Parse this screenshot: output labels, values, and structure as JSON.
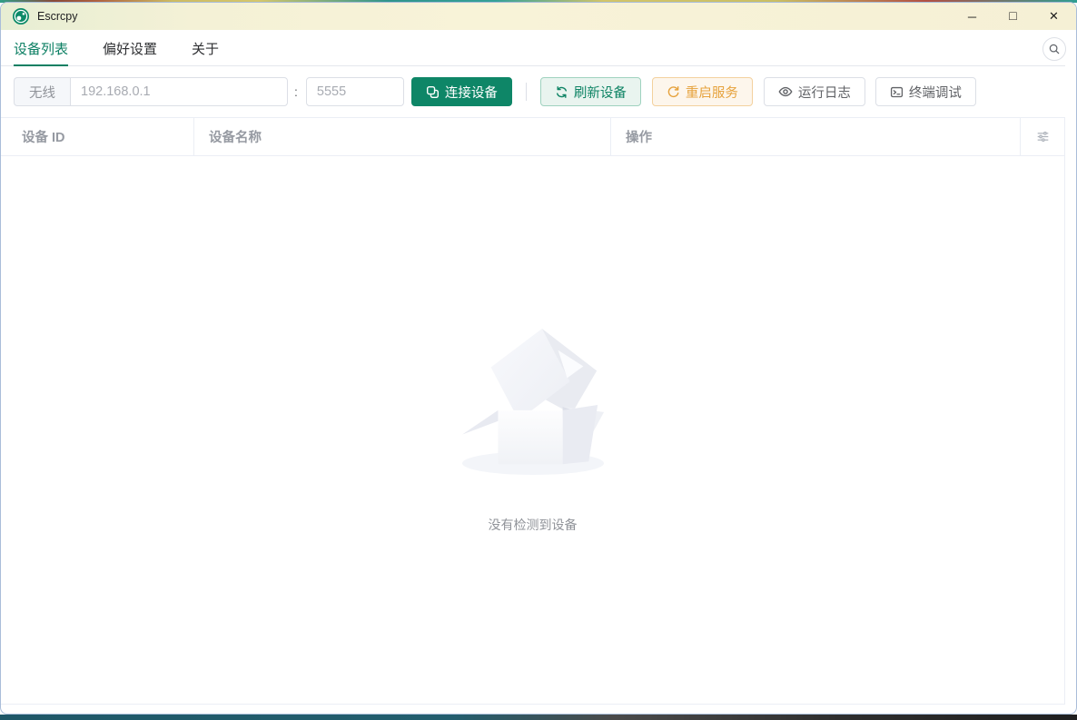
{
  "window": {
    "title": "Escrcpy",
    "controls": {
      "minimize": "─",
      "maximize": "□",
      "close": "✕"
    }
  },
  "tabs": [
    {
      "label": "设备列表",
      "active": true
    },
    {
      "label": "偏好设置",
      "active": false
    },
    {
      "label": "关于",
      "active": false
    }
  ],
  "toolbar": {
    "wireless_label": "无线",
    "ip_placeholder": "192.168.0.1",
    "port_separator": ":",
    "port_placeholder": "5555",
    "connect_label": "连接设备",
    "refresh_label": "刷新设备",
    "restart_label": "重启服务",
    "log_label": "运行日志",
    "terminal_label": "终端调试"
  },
  "table": {
    "columns": [
      "设备 ID",
      "设备名称",
      "操作"
    ]
  },
  "empty": {
    "description": "没有检测到设备"
  },
  "icons": {
    "app": "escrcpy-logo",
    "connect": "copy-link-squares",
    "refresh": "refresh-arrows",
    "restart": "refresh-right",
    "log": "eye",
    "terminal": "terminal-window",
    "search": "magnifier",
    "column_settings": "sliders",
    "empty_state": "open-box"
  },
  "colors": {
    "primary": "#0e8667",
    "primary_light_bg": "#e9f4ef",
    "primary_light_border": "#9fd2bf",
    "warning": "#e6a23c",
    "warning_bg": "#fdf6ec",
    "warning_border": "#f3d19e",
    "titlebar": "#f7f2d7",
    "table_border": "#ebeef5",
    "muted_text": "#909399"
  }
}
